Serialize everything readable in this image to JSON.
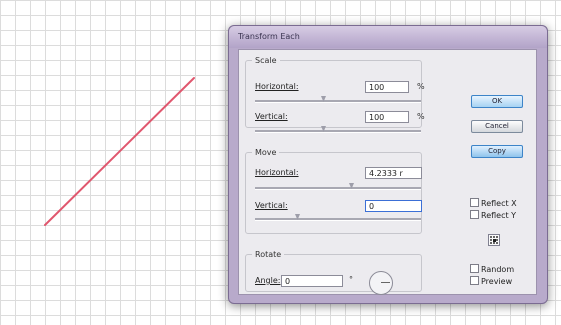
{
  "artwork": {
    "line_color": "#e0576e"
  },
  "dialog": {
    "title": "Transform Each",
    "scale": {
      "legend": "Scale",
      "horizontal_label": "Horizontal:",
      "horizontal_value": "100",
      "horizontal_unit": "%",
      "vertical_label": "Vertical:",
      "vertical_value": "100",
      "vertical_unit": "%"
    },
    "move": {
      "legend": "Move",
      "horizontal_label": "Horizontal:",
      "horizontal_value": "4.2333 r",
      "vertical_label": "Vertical:",
      "vertical_value": "0"
    },
    "rotate": {
      "legend": "Rotate",
      "angle_label": "Angle:",
      "angle_value": "0",
      "angle_unit": "°"
    },
    "buttons": {
      "ok": "OK",
      "cancel": "Cancel",
      "copy": "Copy"
    },
    "options": {
      "reflect_x": "Reflect X",
      "reflect_y": "Reflect Y",
      "random": "Random",
      "preview": "Preview"
    }
  }
}
